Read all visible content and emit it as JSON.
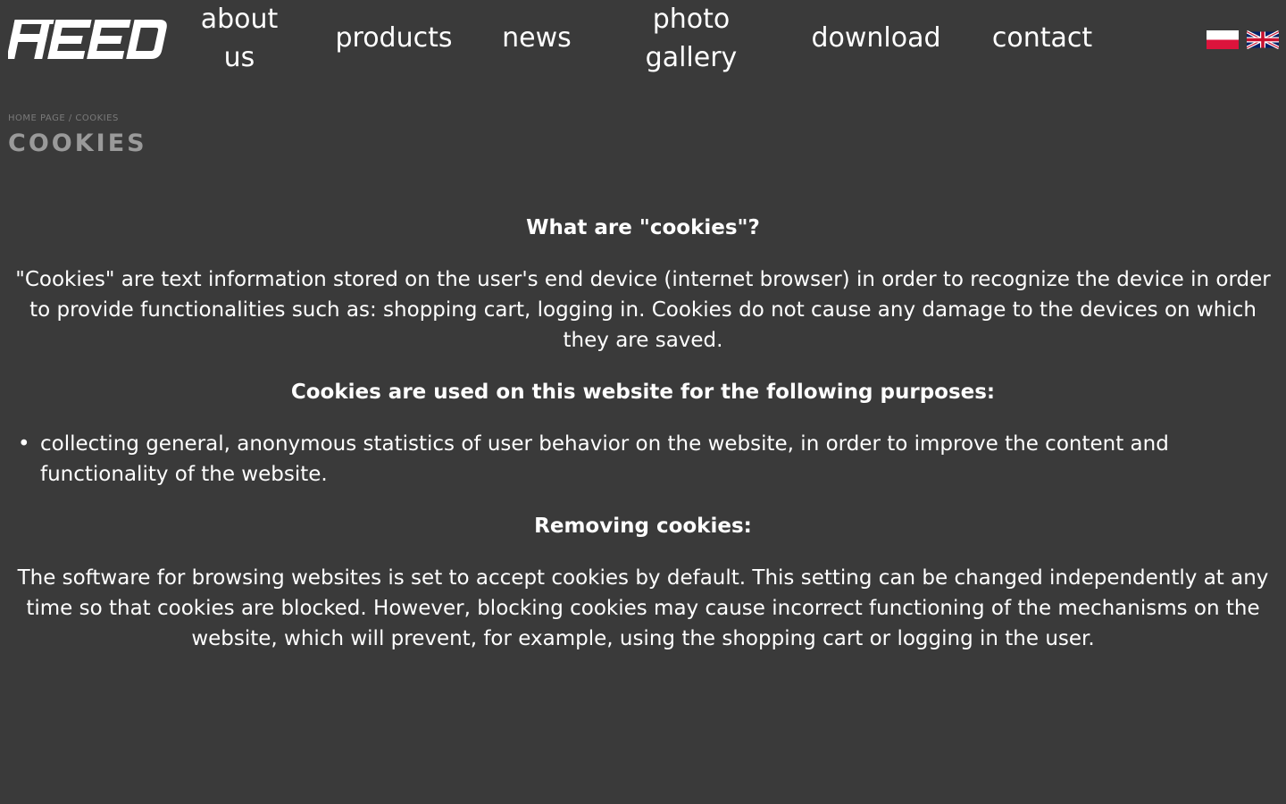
{
  "brand": {
    "logo_text": "HEED"
  },
  "nav": {
    "about_line1": "about",
    "about_line2": "us",
    "products": "products",
    "news": "news",
    "gallery_line1": "photo",
    "gallery_line2": "gallery",
    "download": "download",
    "contact": "contact"
  },
  "languages": [
    {
      "code": "pl",
      "icon": "poland-flag-icon"
    },
    {
      "code": "en",
      "icon": "uk-flag-icon"
    }
  ],
  "breadcrumb": {
    "home": "HOME PAGE",
    "separator": "/",
    "current": "COOKIES"
  },
  "page": {
    "title": "COOKIES"
  },
  "content": {
    "heading_what": "What are \"cookies\"?",
    "paragraph_what": "\"Cookies\" are text information stored on the user's end device (internet browser) in order to recognize the device in order to provide functionalities such as: shopping cart, logging in. Cookies do not cause any damage to the devices on which they are saved.",
    "heading_purposes": "Cookies are used on this website for the following purposes:",
    "purposes": [
      "collecting general, anonymous statistics of user behavior on the website, in order to improve the content and functionality of the website."
    ],
    "heading_removing": "Removing cookies:",
    "paragraph_removing": "The software for browsing websites is set to accept cookies by default. This setting can be changed independently at any time so that cookies are blocked. However, blocking cookies may cause incorrect functioning of the mechanisms on the website, which will prevent, for example, using the shopping cart or logging in the user."
  },
  "colors": {
    "background": "#3a3a3a",
    "text": "#ffffff",
    "muted": "#9a9a9a",
    "breadcrumb": "#7a7a7a",
    "pl_red": "#dc143c",
    "uk_blue": "#012169",
    "uk_red": "#c8102e"
  }
}
